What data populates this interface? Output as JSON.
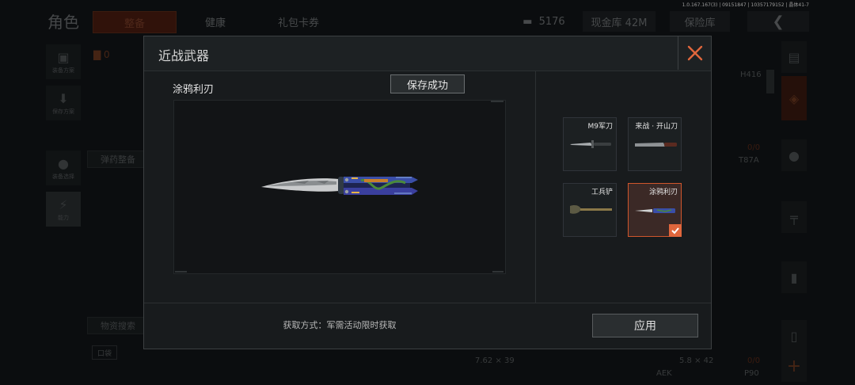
{
  "version": "1.0.167.167(3) | 09151847 | 10357179152 | 晶体41-7",
  "background": {
    "page_title": "角色",
    "tabs": [
      "整备",
      "健康",
      "礼包卡券"
    ],
    "currency": "5176",
    "cash_storage": "现金库 42M",
    "safe": "保险库",
    "back_icon": "back-arrow-icon",
    "left_nav": [
      "装备方案",
      "保存方案",
      "装备选择",
      "能力"
    ],
    "ammo_count": "0",
    "ammo_button": "弹药整备",
    "supply_button": "物资搜索",
    "pocket_label": "口袋",
    "right_labels": {
      "gun1": "H416",
      "gun2": "T87A",
      "count": "0/0",
      "cal1": "7.62 × 39",
      "cal2": "5.8 × 42",
      "gun3": "AEK",
      "gun4": "P90",
      "count2": "0/0"
    }
  },
  "modal": {
    "title": "近战武器",
    "weapon_name": "涂鸦利刃",
    "save_status": "保存成功",
    "acquire_text": "获取方式：军需活动限时获取",
    "apply_label": "应用",
    "close_icon": "close-x-icon",
    "accent_color": "#e0663c",
    "weapons": [
      {
        "label": "M9军刀",
        "selected": false
      },
      {
        "label": "来战 · 开山刀",
        "selected": false
      },
      {
        "label": "工兵铲",
        "selected": false
      },
      {
        "label": "涂鸦利刃",
        "selected": true
      }
    ]
  }
}
